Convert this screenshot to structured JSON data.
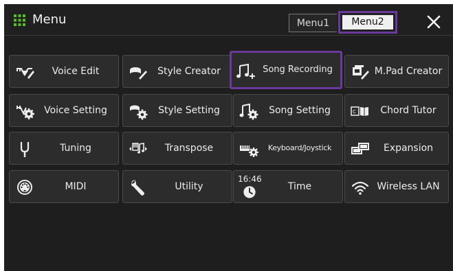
{
  "header": {
    "title": "Menu",
    "tabs": [
      {
        "label": "Menu1",
        "active": false
      },
      {
        "label": "Menu2",
        "active": true
      }
    ],
    "close_icon": "close-icon",
    "grid_icon": "grid-menu-icon"
  },
  "buttons": [
    {
      "label": "Voice Edit",
      "icon": "voice-edit-icon"
    },
    {
      "label": "Style Creator",
      "icon": "style-creator-icon"
    },
    {
      "label": "Song Recording",
      "icon": "song-recording-icon",
      "selected": true
    },
    {
      "label": "M.Pad Creator",
      "icon": "mpad-creator-icon"
    },
    {
      "label": "Voice Setting",
      "icon": "voice-setting-icon"
    },
    {
      "label": "Style Setting",
      "icon": "style-setting-icon"
    },
    {
      "label": "Song Setting",
      "icon": "song-setting-icon"
    },
    {
      "label": "Chord Tutor",
      "icon": "chord-tutor-icon"
    },
    {
      "label": "Tuning",
      "icon": "tuning-fork-icon"
    },
    {
      "label": "Transpose",
      "icon": "transpose-icon"
    },
    {
      "label": "Keyboard/Joystick",
      "icon": "keyboard-joystick-icon"
    },
    {
      "label": "Expansion",
      "icon": "expansion-icon"
    },
    {
      "label": "MIDI",
      "icon": "midi-icon"
    },
    {
      "label": "Utility",
      "icon": "wrench-icon"
    },
    {
      "label": "Time",
      "icon": "clock-icon",
      "time": "16:46"
    },
    {
      "label": "Wireless LAN",
      "icon": "wifi-icon"
    }
  ],
  "colors": {
    "background": "#1e1e1e",
    "button": "#2c2c2c",
    "selection": "#6a3a9c",
    "grid_icon": "#55c02a"
  }
}
